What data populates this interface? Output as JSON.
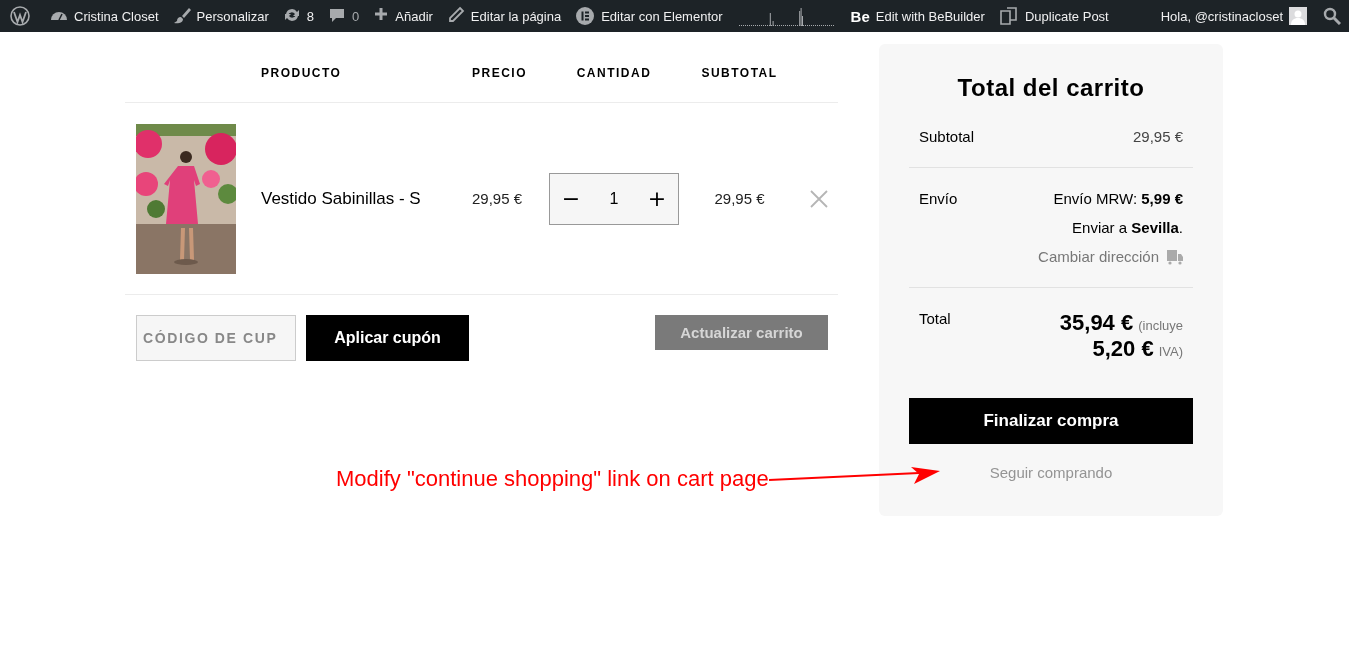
{
  "admin_bar": {
    "items": [
      {
        "kind": "wp-logo"
      },
      {
        "kind": "site",
        "label": "Cristina Closet"
      },
      {
        "kind": "customize",
        "label": "Personalizar"
      },
      {
        "kind": "updates",
        "label": "8"
      },
      {
        "kind": "comments",
        "label": "0"
      },
      {
        "kind": "new",
        "label": "Añadir"
      },
      {
        "kind": "edit",
        "label": "Editar la página"
      },
      {
        "kind": "elementor",
        "label": "Editar con Elementor"
      },
      {
        "kind": "sparkline"
      },
      {
        "kind": "bebuilder",
        "logo": "Be",
        "label": "Edit with BeBuilder"
      },
      {
        "kind": "duplicate",
        "label": "Duplicate Post"
      }
    ],
    "account": {
      "label": "Hola, @cristinacloset"
    }
  },
  "cart": {
    "columns": [
      "PRODUCTO",
      "PRECIO",
      "CANTIDAD",
      "SUBTOTAL"
    ],
    "rows": [
      {
        "name": "Vestido Sabinillas - S",
        "price": "29,95 €",
        "quantity": "1",
        "decrease": "−",
        "increase": "+",
        "subtotal": "29,95 €"
      }
    ],
    "coupon": {
      "placeholder": "CÓDIGO DE CUP",
      "apply_button": "Aplicar cupón"
    },
    "update_button": {
      "label": "Actualizar carrito",
      "disabled": true
    }
  },
  "totals": {
    "title": "Total del carrito",
    "subtotal": {
      "label": "Subtotal",
      "value": "29,95 €"
    },
    "shipping": {
      "label": "Envío",
      "method": "Envío MRW: **5,99 €**",
      "destination": "Enviar a **Sevilla**.",
      "change_link": "Cambiar dirección"
    },
    "total": {
      "label": "Total",
      "value": "35,94 €",
      "tax_prefix": "(incluye",
      "tax_value": "5,20 €",
      "tax_suffix": "IVA)"
    },
    "checkout_button": "Finalizar compra",
    "continue_link": "Seguir comprando"
  },
  "annotation": {
    "text": "Modify \"continue shopping\" link on cart page"
  }
}
